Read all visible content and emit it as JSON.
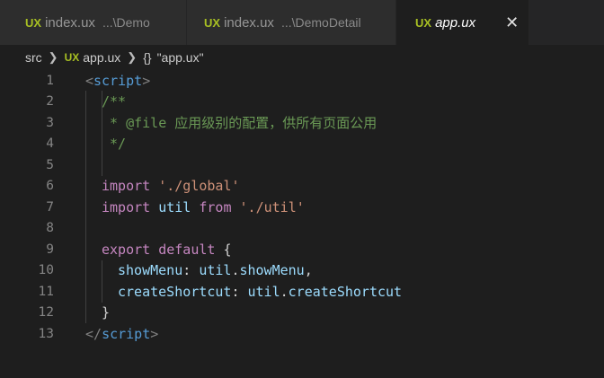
{
  "tabs": [
    {
      "icon": "UX",
      "name": "index.ux",
      "path": "...\\Demo",
      "active": false
    },
    {
      "icon": "UX",
      "name": "index.ux",
      "path": "...\\DemoDetail",
      "active": false
    },
    {
      "icon": "UX",
      "name": "app.ux",
      "path": "",
      "active": true,
      "close": "✕"
    }
  ],
  "breadcrumb": {
    "folder": "src",
    "file_icon": "UX",
    "file": "app.ux",
    "symbol_icon": "{}",
    "symbol": "\"app.ux\""
  },
  "editor": {
    "line_numbers": [
      "1",
      "2",
      "3",
      "4",
      "5",
      "6",
      "7",
      "8",
      "9",
      "10",
      "11",
      "12",
      "13"
    ],
    "lines": {
      "l1_open": "<",
      "l1_tag": "script",
      "l1_close": ">",
      "l2": "/**",
      "l3": " * @file 应用级别的配置，供所有页面公用",
      "l4": " */",
      "l6_kw": "import",
      "l6_str": "'./global'",
      "l7_kw1": "import",
      "l7_var": "util",
      "l7_kw2": "from",
      "l7_str": "'./util'",
      "l9_kw": "export default",
      "l9_brace": "{",
      "l10_prop": "showMenu",
      "l10_colon": ": ",
      "l10_obj": "util",
      "l10_dot": ".",
      "l10_member": "showMenu",
      "l10_comma": ",",
      "l11_prop": "createShortcut",
      "l11_colon": ": ",
      "l11_obj": "util",
      "l11_dot": ".",
      "l11_member": "createShortcut",
      "l12": "}",
      "l13_open": "</",
      "l13_tag": "script",
      "l13_close": ">"
    }
  },
  "colors": {
    "background": "#1e1e1e",
    "tag": "#569cd6",
    "comment": "#6a9955",
    "keyword": "#c586c0",
    "string": "#ce9178",
    "variable": "#9cdcfe",
    "ux_icon": "#a8c023"
  }
}
